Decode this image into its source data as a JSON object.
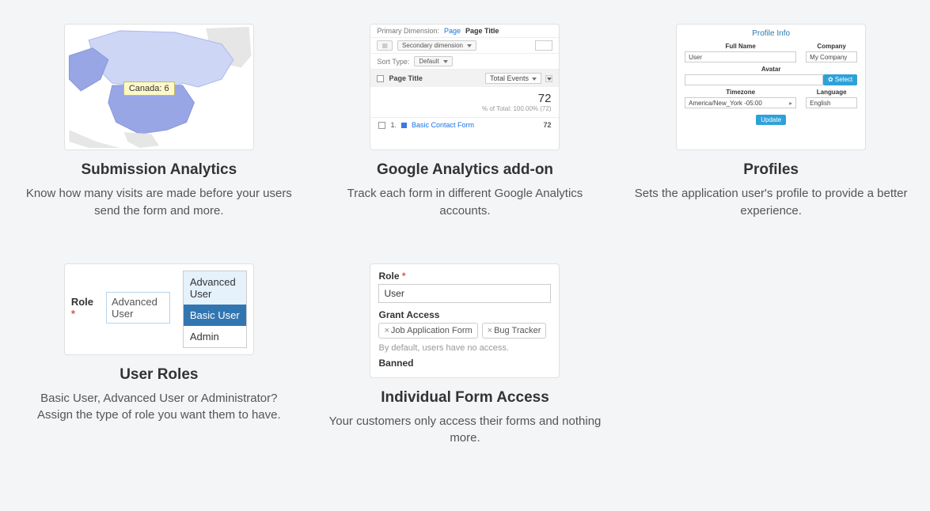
{
  "features": {
    "submission_analytics": {
      "title": "Submission Analytics",
      "desc": "Know how many visits are made before your users send the form and more.",
      "map_tooltip": "Canada: 6"
    },
    "google_analytics": {
      "title": "Google Analytics add-on",
      "desc": "Track each form in different Google Analytics accounts.",
      "primary_dimension_label": "Primary Dimension:",
      "dim_page": "Page",
      "dim_page_title": "Page Title",
      "secondary_dimension": "Secondary dimension",
      "sort_type_label": "Sort Type:",
      "sort_type_value": "Default",
      "col_page_title": "Page Title",
      "col_total_events": "Total Events",
      "total_value": "72",
      "total_pct": "% of Total: 100.00% (72)",
      "row1_index": "1.",
      "row1_label": "Basic Contact Form",
      "row1_value": "72"
    },
    "profiles": {
      "title": "Profiles",
      "desc": "Sets the application user's profile to provide a better experience.",
      "section_title": "Profile Info",
      "full_name_label": "Full Name",
      "full_name_value": "User",
      "company_label": "Company",
      "company_value": "My Company",
      "avatar_label": "Avatar",
      "select_btn": "✿ Select",
      "timezone_label": "Timezone",
      "timezone_value": "America/New_York -05:00",
      "language_label": "Language",
      "language_value": "English",
      "update_btn": "Update"
    },
    "user_roles": {
      "title": "User Roles",
      "desc": "Basic User, Advanced User or Administrator? Assign the type of role you want them to have.",
      "label": "Role",
      "asterisk": "*",
      "selected": "Advanced User",
      "options": [
        "Advanced User",
        "Basic User",
        "Admin"
      ]
    },
    "individual_access": {
      "title": "Individual Form Access",
      "desc": "Your customers only access their forms and nothing more.",
      "role_label": "Role",
      "asterisk": "*",
      "role_value": "User",
      "grant_label": "Grant Access",
      "tags": [
        "Job Application Form",
        "Bug Tracker"
      ],
      "hint": "By default, users have no access.",
      "banned_label": "Banned"
    }
  }
}
